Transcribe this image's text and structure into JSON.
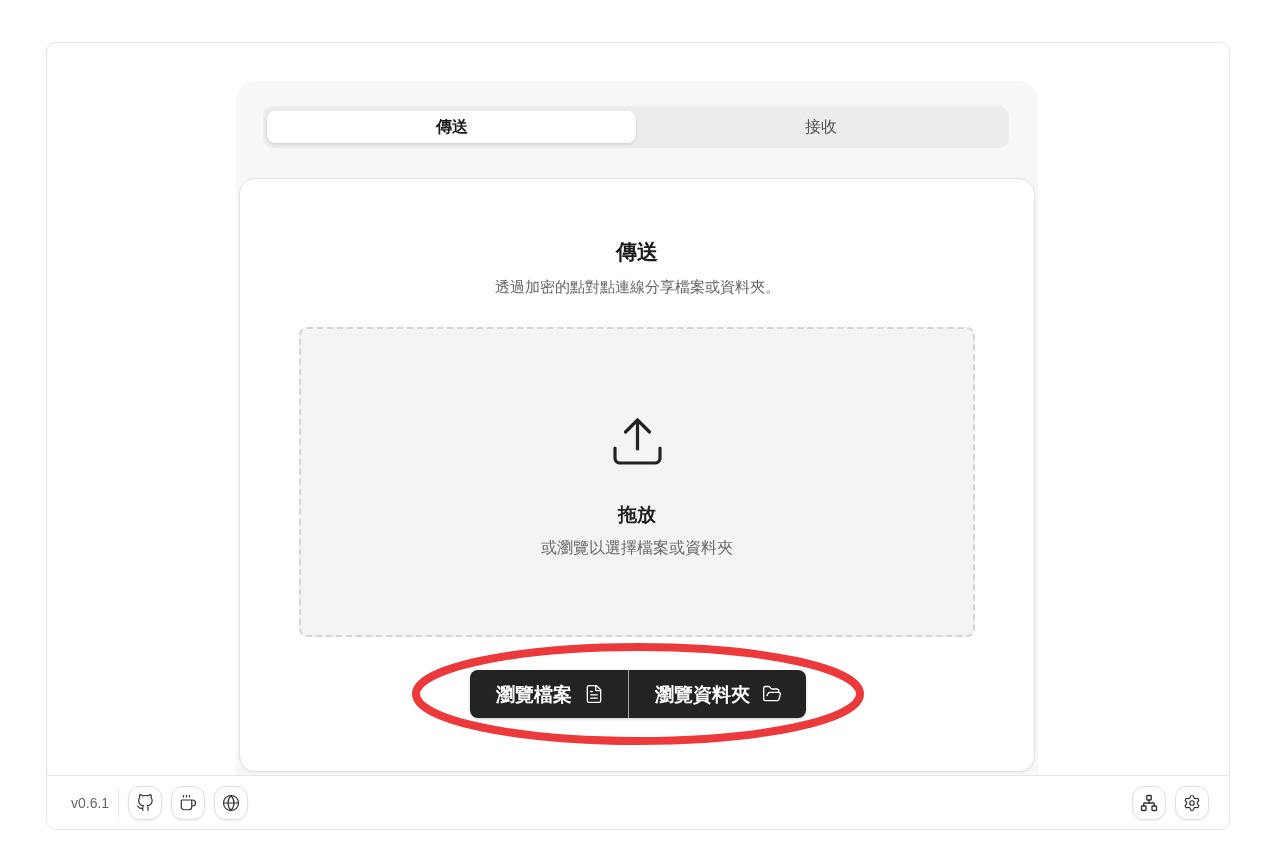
{
  "tabs": [
    {
      "label": "傳送",
      "selected": true
    },
    {
      "label": "接收",
      "selected": false
    }
  ],
  "send_card": {
    "title": "傳送",
    "subtitle": "透過加密的點對點連線分享檔案或資料夾。",
    "dropzone": {
      "title": "拖放",
      "hint": "或瀏覽以選擇檔案或資料夾"
    },
    "buttons": [
      {
        "label": "瀏覽檔案",
        "kind": "file"
      },
      {
        "label": "瀏覽資料夾",
        "kind": "folder"
      }
    ]
  },
  "annotation": {
    "kind": "ellipse"
  },
  "footer": {
    "version": "v0.6.1"
  }
}
